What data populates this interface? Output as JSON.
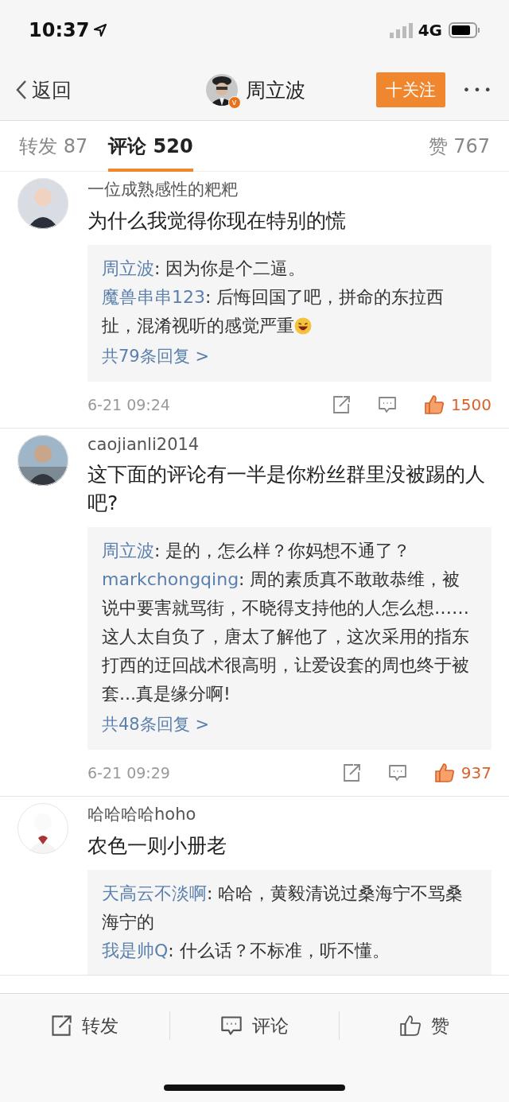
{
  "status_bar": {
    "time": "10:37",
    "network": "4G"
  },
  "nav": {
    "back": "返回",
    "author": {
      "name": "周立波",
      "badge": "v"
    },
    "follow": "十关注",
    "more": "•••"
  },
  "tabs": [
    {
      "label": "转发 87",
      "selected": false
    },
    {
      "label": "评论 520",
      "selected": true
    },
    {
      "label": "赞 767",
      "selected": false
    }
  ],
  "comments": [
    {
      "user": "一位成熟感性的粑粑",
      "avatar": {
        "kind": "picture"
      },
      "text": "为什么我觉得你现在特别的慌",
      "replies": [
        {
          "user": "周立波",
          "text": ": 因为你是个二逼。",
          "emoji": false
        },
        {
          "user": "魔兽串串123",
          "text": ": 后悔回国了吧，拼命的东拉西扯，混淆视听的感觉严重",
          "emoji": true
        }
      ],
      "more_replies": "共79条回复 >",
      "time": "6-21 09:24",
      "likes": "1500",
      "liked": true
    },
    {
      "user": "caojianli2014",
      "avatar": {
        "kind": "picture"
      },
      "text": "这下面的评论有一半是你粉丝群里没被踢的人吧?",
      "replies": [
        {
          "user": "周立波",
          "text": ": 是的，怎么样？你妈想不通了？"
        },
        {
          "user": "markchongqing",
          "text": ": 周的素质真不敢敢恭维，被说中要害就骂街，不晓得支持他的人怎么想……这人太自负了，唐太了解他了，这次采用的指东打西的迂回战术很高明，让爱设套的周也终于被套...真是缘分啊!"
        }
      ],
      "more_replies": "共48条回复 >",
      "time": "6-21 09:29",
      "likes": "937",
      "liked": true
    },
    {
      "user": "哈哈哈哈hoho",
      "avatar": {
        "kind": "picture"
      },
      "text": "农色一则小册老",
      "replies": [
        {
          "user": "天高云不淡啊",
          "text": ": 哈哈，黄毅清说过桑海宁不骂桑海宁的"
        },
        {
          "user": "我是帅Q",
          "text": ": 什么话？不标准，听不懂。"
        }
      ]
    }
  ],
  "bottom_bar": [
    {
      "kind": "share",
      "label": "转发"
    },
    {
      "kind": "comment",
      "label": "评论"
    },
    {
      "kind": "like",
      "label": "赞"
    }
  ]
}
